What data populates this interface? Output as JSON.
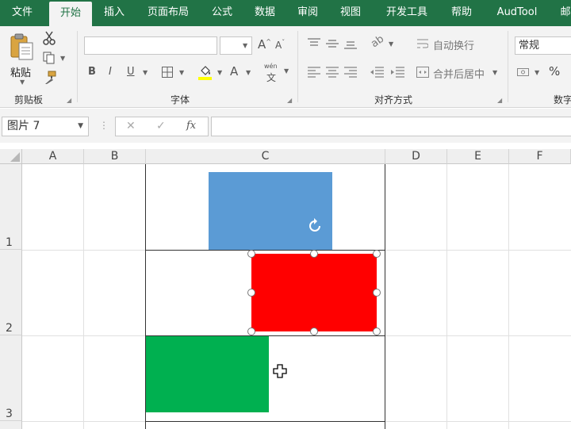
{
  "tabs": [
    {
      "label": "文件"
    },
    {
      "label": "开始",
      "active": true
    },
    {
      "label": "插入"
    },
    {
      "label": "页面布局"
    },
    {
      "label": "公式"
    },
    {
      "label": "数据"
    },
    {
      "label": "审阅"
    },
    {
      "label": "视图"
    },
    {
      "label": "开发工具"
    },
    {
      "label": "帮助"
    },
    {
      "label": "AudTool"
    },
    {
      "label": "邮"
    }
  ],
  "ribbon": {
    "clipboard": {
      "paste_label": "粘贴",
      "group_label": "剪贴板"
    },
    "font": {
      "group_label": "字体",
      "bold": "B",
      "italic": "I",
      "underline": "U",
      "font_color": "A",
      "phonetic_top": "wén",
      "phonetic_bottom": "文"
    },
    "alignment": {
      "group_label": "对齐方式",
      "wrap_text": "自动换行",
      "merge_center": "合并后居中"
    },
    "number": {
      "group_label": "数字",
      "format_value": "常规",
      "percent": "%"
    }
  },
  "formula_bar": {
    "name_box": "图片 7",
    "cancel": "✕",
    "enter": "✓",
    "fx": "fx",
    "formula": ""
  },
  "grid": {
    "columns": [
      "A",
      "B",
      "C",
      "D",
      "E",
      "F"
    ],
    "rows": [
      "1",
      "2",
      "3"
    ]
  },
  "shapes": {
    "blue_color": "#5b9bd5",
    "red_color": "#ff0000",
    "green_color": "#00b050"
  }
}
